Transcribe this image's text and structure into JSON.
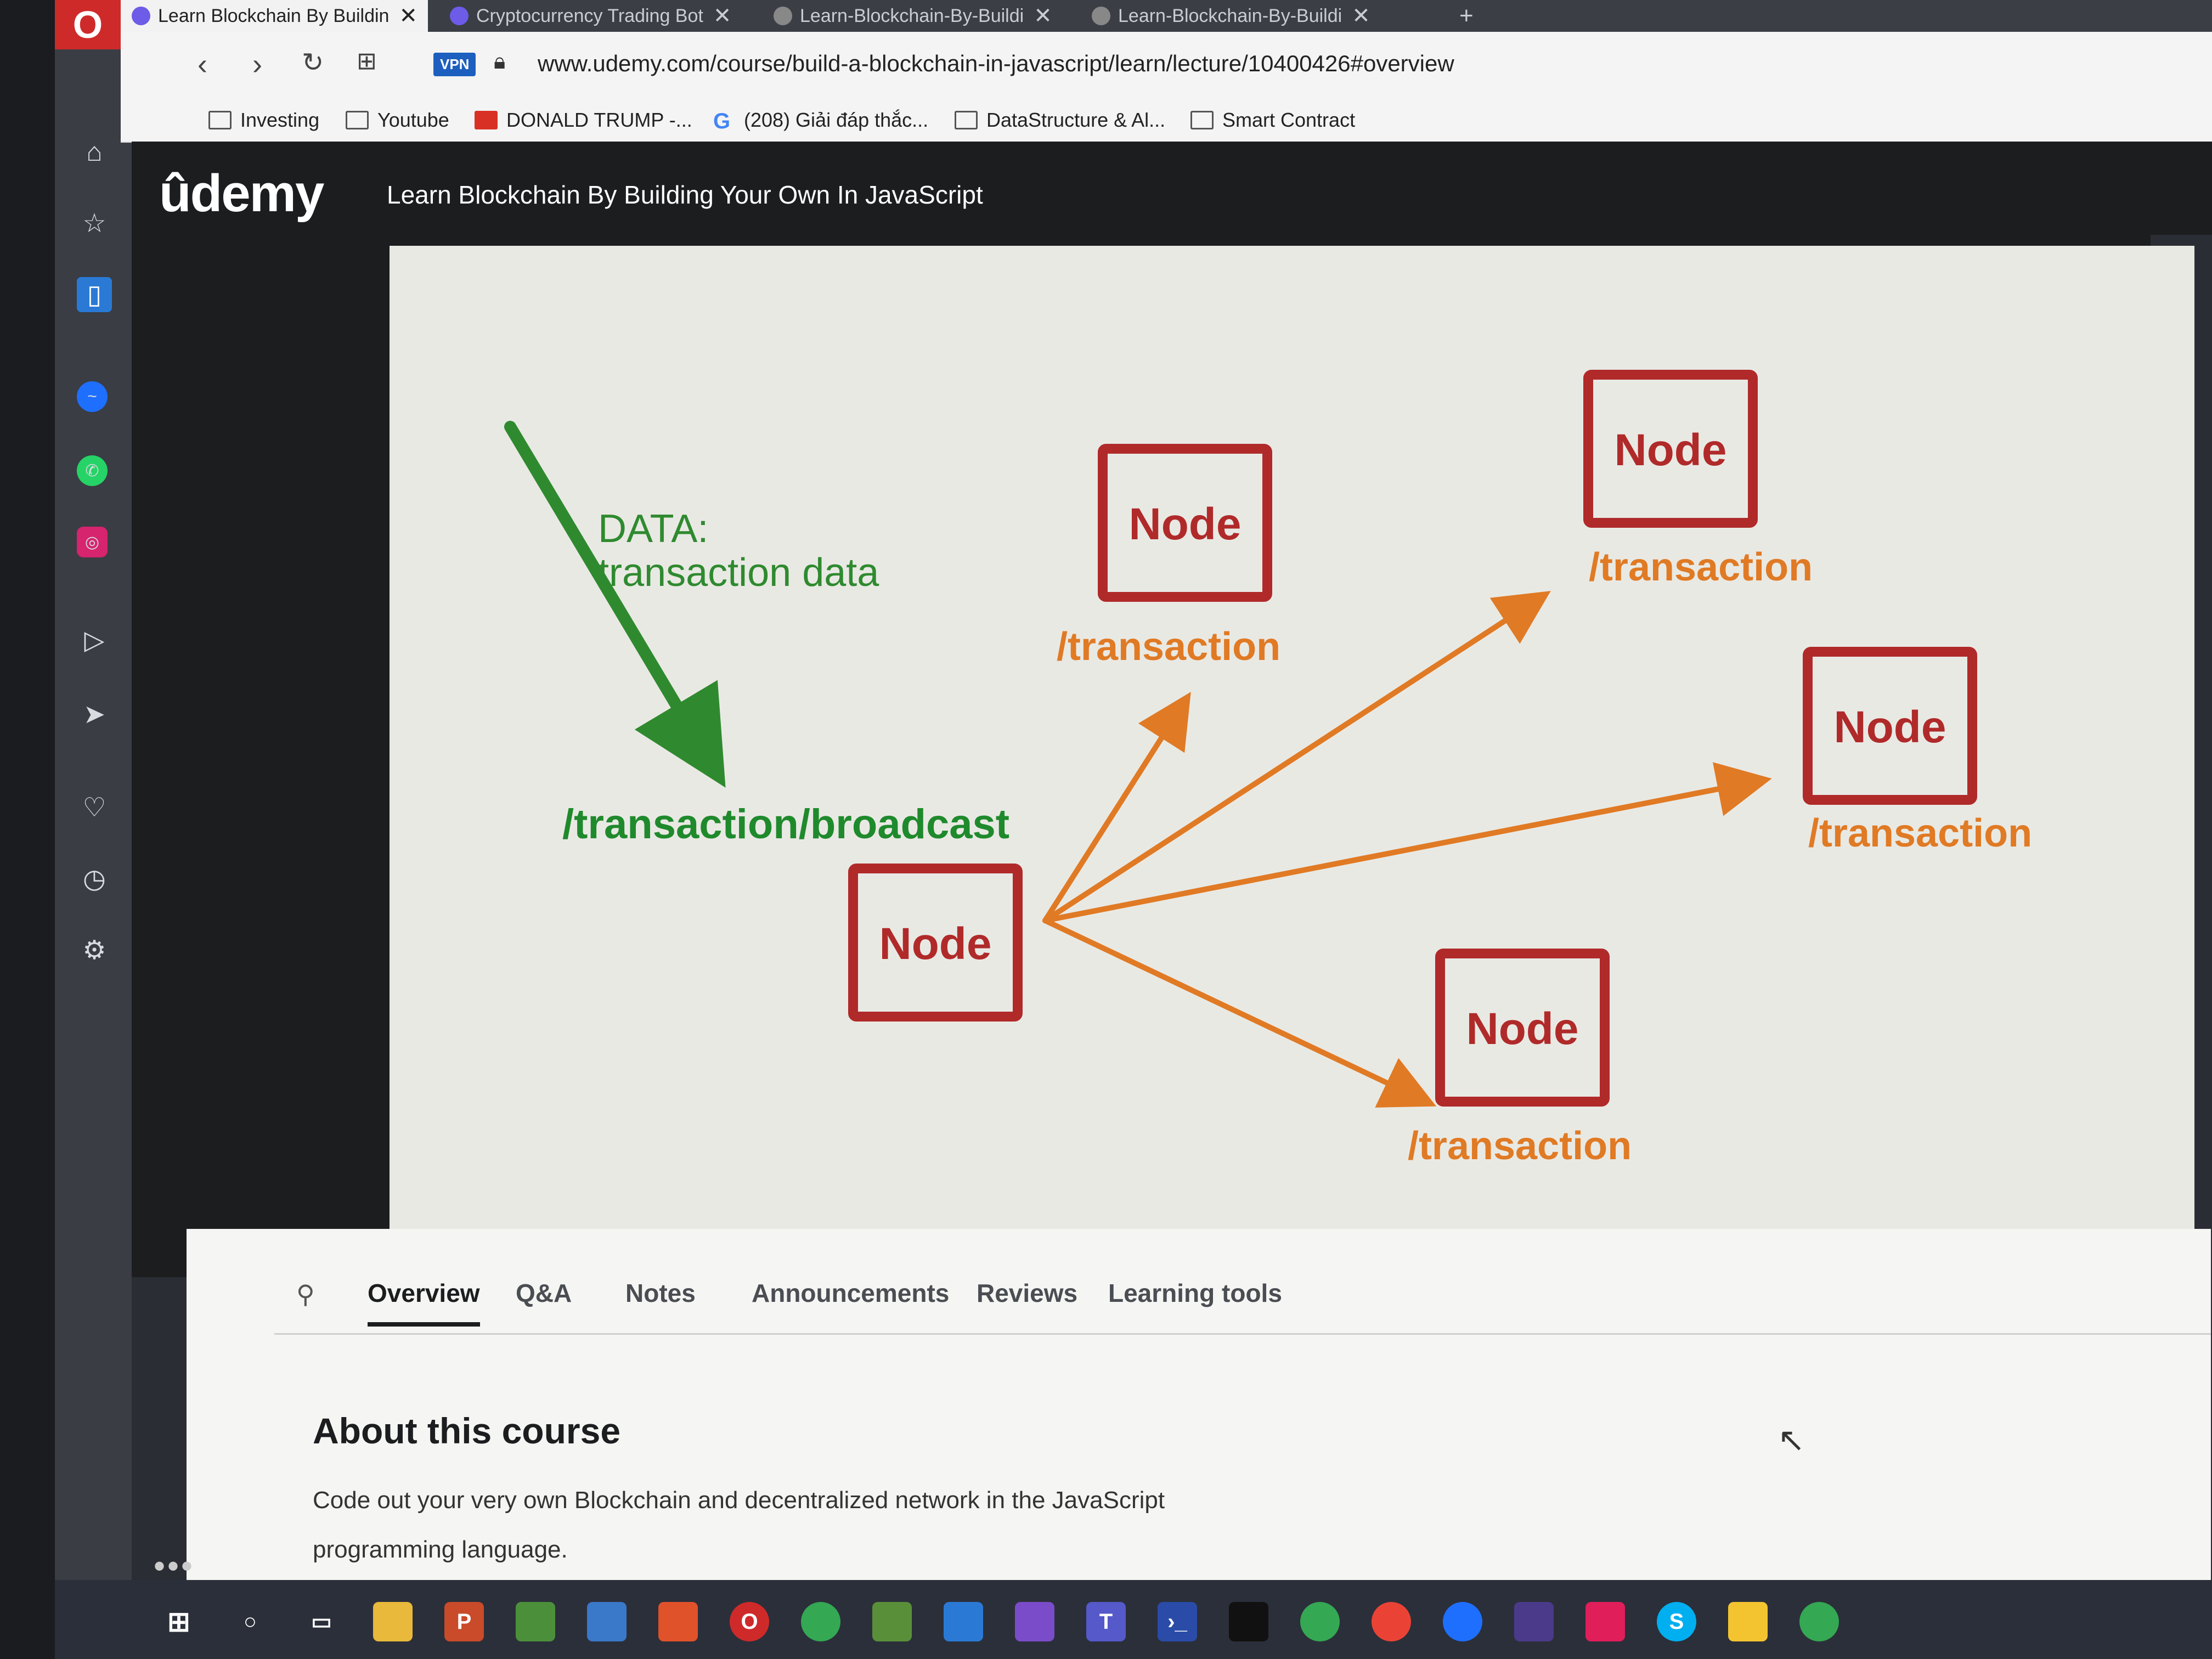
{
  "browser": {
    "tabs": [
      {
        "title": "Learn Blockchain By Buildin",
        "active": true
      },
      {
        "title": "Cryptocurrency Trading Bot",
        "active": false
      },
      {
        "title": "Learn-Blockchain-By-Buildi",
        "active": false
      },
      {
        "title": "Learn-Blockchain-By-Buildi",
        "active": false
      }
    ],
    "new_tab": "+",
    "vpn_badge": "VPN",
    "url": "www.udemy.com/course/build-a-blockchain-in-javascript/learn/lecture/10400426#overview",
    "bookmarks": [
      {
        "label": "Investing",
        "icon": "folder-icon"
      },
      {
        "label": "Youtube",
        "icon": "folder-icon"
      },
      {
        "label": "DONALD TRUMP -...",
        "icon": "news-icon"
      },
      {
        "label": "(208) Giải đáp thắc...",
        "icon": "google-icon"
      },
      {
        "label": "DataStructure & Al...",
        "icon": "folder-icon"
      },
      {
        "label": "Smart Contract",
        "icon": "folder-icon"
      }
    ]
  },
  "udemy": {
    "logo": "ûdemy",
    "course_title": "Learn Blockchain By Building Your Own In JavaScript"
  },
  "slide": {
    "data_line1": "DATA:",
    "data_line2": "transaction data",
    "broadcast_endpoint": "/transaction/broadcast",
    "node_text": "Node",
    "route_text": "/transaction",
    "colors": {
      "node": "#b02a2a",
      "route": "#e07a24",
      "data": "#2f8a2f"
    }
  },
  "course_tabs": [
    "Overview",
    "Q&A",
    "Notes",
    "Announcements",
    "Reviews",
    "Learning tools"
  ],
  "about": {
    "title": "About this course",
    "description_line1": "Code out your very own Blockchain and decentralized network in the JavaScript",
    "description_line2": "programming language."
  }
}
